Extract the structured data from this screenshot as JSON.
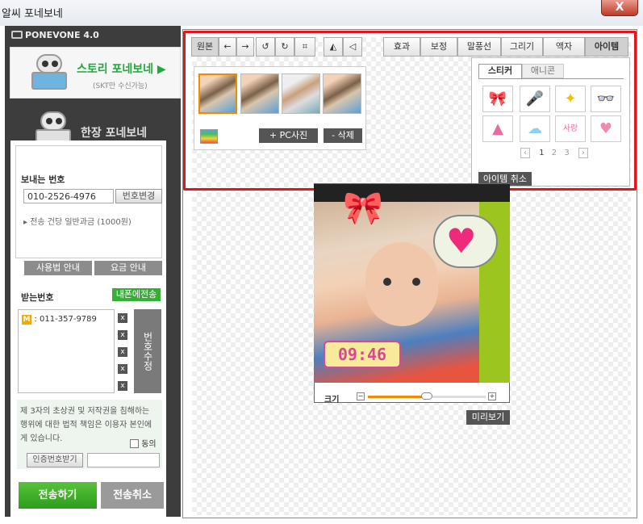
{
  "window": {
    "title": "알씨 포네보네",
    "close_label": "X"
  },
  "sidebar": {
    "brand": "PONEVONE 4.0",
    "story": {
      "title": "스토리 포네보네 ▶",
      "subtitle": "(SKT만 수신가능)"
    },
    "single": {
      "title": "한장 포네보네"
    },
    "sender": {
      "label": "보내는 번호",
      "number": "010-2526-4976",
      "change_button": "번호변경",
      "fee_note": "전송 건당 일반과금 (1000원)",
      "usage_button": "사용법 안내",
      "fee_button": "요금 안내"
    },
    "receiver": {
      "label": "받는번호",
      "send_mine_button": "내폰에전송",
      "numbers": [
        {
          "badge": "M",
          "number": ": 011-357-9789"
        }
      ],
      "edit_button": "번호수정"
    },
    "agreement": {
      "text": "제 3자의 초상권 및 저작권을 침해하는 행위에 대한 법적 책임은 이용자 본인에게 있습니다.",
      "agree_label": "동의",
      "auth_button": "인증번호받기",
      "auth_input": ""
    },
    "send_button": "전송하기",
    "cancel_button": "전송취소"
  },
  "toolbar": {
    "original": "원본",
    "tabs": [
      "효과",
      "보정",
      "말풍선",
      "그리기",
      "액자",
      "아이템"
    ],
    "active_tab": "아이템"
  },
  "thumbs": {
    "count": 4,
    "pc_button": "+ PC사진",
    "delete_button": "- 삭제"
  },
  "items": {
    "tabs": [
      "스티커",
      "애니콘"
    ],
    "active_tab": "스티커",
    "stickers": [
      "ribbon",
      "microphone",
      "star",
      "glasses",
      "party-hat",
      "cloud",
      "love-text",
      "heart"
    ],
    "pages": [
      "1",
      "2",
      "3"
    ],
    "current_page": "1",
    "prev": "‹",
    "next": "›",
    "cancel_button": "아이템 취소"
  },
  "photo": {
    "clock": "09:46",
    "size_label": "크기",
    "size_level": 0.5,
    "preview_button": "미리보기"
  },
  "colors": {
    "accent": "#e8141b",
    "green": "#34b034",
    "sidebar": "#3d3d3d"
  }
}
